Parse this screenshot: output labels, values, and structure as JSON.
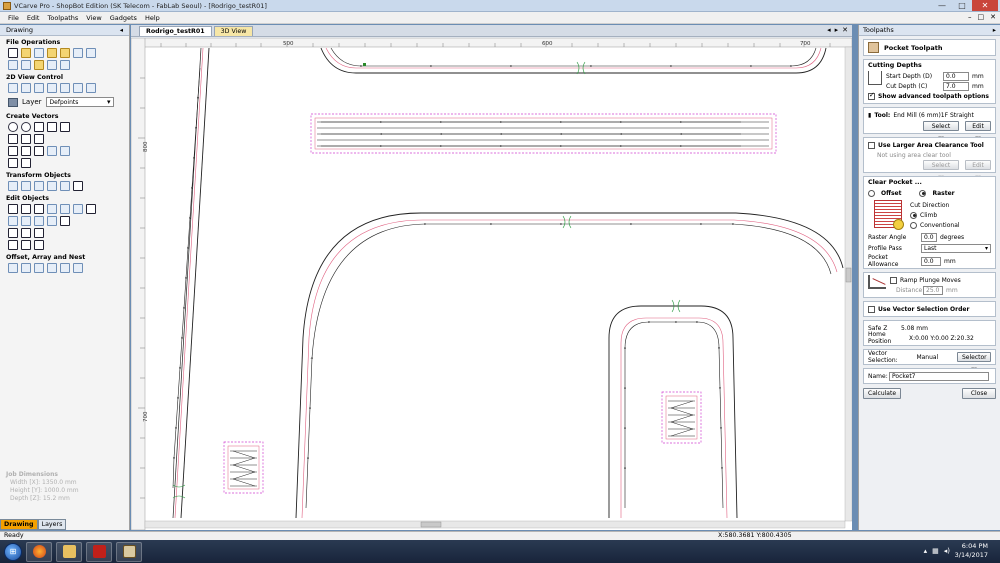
{
  "window": {
    "title": "VCarve Pro - ShopBot Edition (SK Telecom - FabLab Seoul) - [Rodrigo_testR01]",
    "minimize": "—",
    "maximize": "□",
    "close": "✕"
  },
  "menu": {
    "items": [
      "File",
      "Edit",
      "Toolpaths",
      "View",
      "Gadgets",
      "Help"
    ],
    "mdi_min": "–",
    "mdi_restore": "□",
    "mdi_close": "✕"
  },
  "left_panel": {
    "title": "Drawing",
    "sections": {
      "file_ops": "File Operations",
      "view_control": "2D View Control",
      "create_vectors": "Create Vectors",
      "transform": "Transform Objects",
      "edit": "Edit Objects",
      "offset": "Offset, Array and Nest"
    },
    "layer_label": "Layer",
    "layer_value": "Defpoints",
    "job_dims": {
      "title": "Job Dimensions",
      "width": "Width  [X]: 1350.0 mm",
      "height": "Height [Y]: 1000.0 mm",
      "depth": "Depth  [Z]: 15.2 mm"
    },
    "tabs": [
      "Drawing",
      "Layers"
    ]
  },
  "document": {
    "tabs": [
      "Rodrigo_testR01",
      "3D View"
    ],
    "ruler_top": [
      "500",
      "600",
      "700"
    ],
    "ruler_left": [
      "800",
      "700"
    ]
  },
  "right_panel": {
    "title": "Toolpaths",
    "toolpath_title": "Pocket Toolpath",
    "cutting_depths": {
      "title": "Cutting Depths",
      "start_label": "Start Depth (D)",
      "start_value": "0.0",
      "cut_label": "Cut Depth (C)",
      "cut_value": "7.0",
      "unit": "mm"
    },
    "show_advanced": "Show advanced toolpath options",
    "tool": {
      "label": "Tool:",
      "value": "End Mill (6 mm)1F Straight",
      "select": "Select ...",
      "edit": "Edit ..."
    },
    "clearance": {
      "title": "Use Larger Area Clearance Tool",
      "note": "Not using area clear tool",
      "select": "Select ...",
      "edit": "Edit ..."
    },
    "clear_pocket": {
      "title": "Clear Pocket ...",
      "offset": "Offset",
      "raster": "Raster",
      "cut_direction": "Cut Direction",
      "climb": "Climb",
      "conventional": "Conventional",
      "raster_angle_label": "Raster Angle",
      "raster_angle_value": "0.0",
      "raster_angle_unit": "degrees",
      "profile_pass_label": "Profile Pass",
      "profile_pass_value": "Last",
      "allowance_label": "Pocket Allowance",
      "allowance_value": "0.0",
      "allowance_unit": "mm"
    },
    "ramp": {
      "label": "Ramp Plunge Moves",
      "distance_label": "Distance",
      "distance_value": "25.0",
      "unit": "mm"
    },
    "vector_order": "Use Vector Selection Order",
    "safe_z_label": "Safe Z",
    "safe_z_value": "5.08 mm",
    "home_label": "Home Position",
    "home_value": "X:0.00 Y:0.00 Z:20.32",
    "vector_sel_label": "Vector Selection:",
    "vector_sel_value": "Manual",
    "selector_btn": "Selector ...",
    "name_label": "Name:",
    "name_value": "Pocket7",
    "calculate": "Calculate",
    "close": "Close"
  },
  "status": {
    "ready": "Ready",
    "coords": "X:580.3681 Y:800.4305"
  },
  "taskbar": {
    "time": "6:04 PM",
    "date": "3/14/2017"
  }
}
